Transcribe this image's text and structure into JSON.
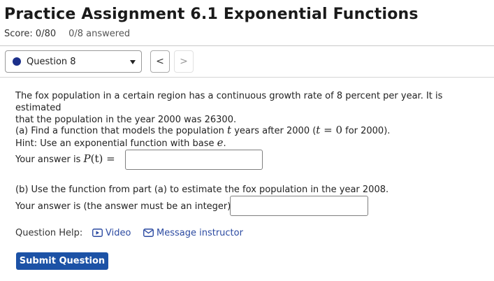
{
  "header": {
    "title": "Practice Assignment 6.1 Exponential Functions",
    "score": "Score: 0/80",
    "answered": "0/8 answered"
  },
  "question_nav": {
    "selected": "Question 8",
    "prev_label": "<",
    "next_label": ">",
    "status_color": "#1c2f8a"
  },
  "question": {
    "intro_line1": "The fox population in a certain region has a continuous growth rate of 8 percent per year. It is estimated",
    "intro_line2": "that the population in the year 2000 was 26300.",
    "part_a": {
      "text_before_t": "(a) Find a function that models the population ",
      "var_t": "t",
      "text_mid": " years after 2000 (",
      "t_eq": "t",
      "eq_sign": " = ",
      "zero": "0",
      "text_after": " for 2000).",
      "hint_prefix": "Hint: Use an exponential function with base ",
      "hint_e": "e",
      "hint_suffix": ".",
      "answer_prefix": "Your answer is ",
      "answer_fn": "P",
      "answer_paren": "(t) =",
      "input_value": ""
    },
    "part_b": {
      "text": "(b) Use the function from part (a) to estimate the fox population in the year 2008.",
      "answer_prefix": "Your answer is (the answer must be an integer)",
      "input_value": ""
    }
  },
  "help": {
    "label": "Question Help:",
    "video": "Video",
    "message": "Message instructor"
  },
  "submit": {
    "label": "Submit Question",
    "color": "#1c52a6"
  }
}
